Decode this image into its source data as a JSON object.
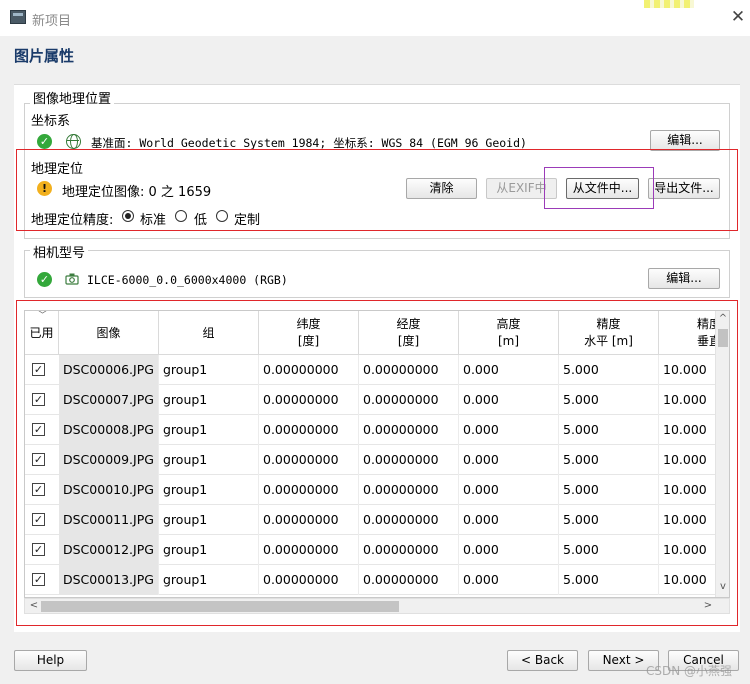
{
  "window": {
    "title": "新项目",
    "close_glyph": "✕"
  },
  "page_title": "图片属性",
  "geo_position": {
    "group_title": "图像地理位置",
    "crs_label": "坐标系",
    "crs_value": "基准面: World Geodetic System 1984; 坐标系: WGS 84 (EGM 96 Geoid)",
    "edit_button": "编辑..."
  },
  "georef": {
    "title": "地理定位",
    "status_text": "地理定位图像: 0 之 1659",
    "accuracy_label": "地理定位精度:",
    "accuracy_options": [
      "标准",
      "低",
      "定制"
    ],
    "accuracy_selected": "标准",
    "buttons": {
      "clear": "清除",
      "from_exif": "从EXIF中",
      "from_file": "从文件中...",
      "export": "导出文件..."
    }
  },
  "camera": {
    "group_title": "相机型号",
    "model": "ILCE-6000_0.0_6000x4000 (RGB)",
    "edit_button": "编辑..."
  },
  "table": {
    "sort_glyph": "﹀",
    "columns": [
      {
        "l1": "已用",
        "l2": ""
      },
      {
        "l1": "图像",
        "l2": ""
      },
      {
        "l1": "组",
        "l2": ""
      },
      {
        "l1": "纬度",
        "l2": "[度]"
      },
      {
        "l1": "经度",
        "l2": "[度]"
      },
      {
        "l1": "高度",
        "l2": "[m]"
      },
      {
        "l1": "精度",
        "l2": "水平 [m]"
      },
      {
        "l1": "精度",
        "l2": "垂直"
      }
    ],
    "rows": [
      {
        "enabled": "✓",
        "image": "DSC00006.JPG",
        "group": "group1",
        "lat": "0.00000000",
        "lon": "0.00000000",
        "alt": "0.000",
        "acc_h": "5.000",
        "acc_v": "10.000"
      },
      {
        "enabled": "✓",
        "image": "DSC00007.JPG",
        "group": "group1",
        "lat": "0.00000000",
        "lon": "0.00000000",
        "alt": "0.000",
        "acc_h": "5.000",
        "acc_v": "10.000"
      },
      {
        "enabled": "✓",
        "image": "DSC00008.JPG",
        "group": "group1",
        "lat": "0.00000000",
        "lon": "0.00000000",
        "alt": "0.000",
        "acc_h": "5.000",
        "acc_v": "10.000"
      },
      {
        "enabled": "✓",
        "image": "DSC00009.JPG",
        "group": "group1",
        "lat": "0.00000000",
        "lon": "0.00000000",
        "alt": "0.000",
        "acc_h": "5.000",
        "acc_v": "10.000"
      },
      {
        "enabled": "✓",
        "image": "DSC00010.JPG",
        "group": "group1",
        "lat": "0.00000000",
        "lon": "0.00000000",
        "alt": "0.000",
        "acc_h": "5.000",
        "acc_v": "10.000"
      },
      {
        "enabled": "✓",
        "image": "DSC00011.JPG",
        "group": "group1",
        "lat": "0.00000000",
        "lon": "0.00000000",
        "alt": "0.000",
        "acc_h": "5.000",
        "acc_v": "10.000"
      },
      {
        "enabled": "✓",
        "image": "DSC00012.JPG",
        "group": "group1",
        "lat": "0.00000000",
        "lon": "0.00000000",
        "alt": "0.000",
        "acc_h": "5.000",
        "acc_v": "10.000"
      },
      {
        "enabled": "✓",
        "image": "DSC00013.JPG",
        "group": "group1",
        "lat": "0.00000000",
        "lon": "0.00000000",
        "alt": "0.000",
        "acc_h": "5.000",
        "acc_v": "10.000"
      }
    ],
    "scroll_left": "<",
    "scroll_right": ">",
    "scroll_up": "^",
    "scroll_down": "v"
  },
  "footer": {
    "help": "Help",
    "back": "< Back",
    "next": "Next >",
    "cancel": "Cancel"
  },
  "watermark": "CSDN @小燕强",
  "colors": {
    "highlight_red": "#e0272b",
    "highlight_purple": "#9b3bb8",
    "title_blue": "#1a3b6a",
    "ok_green": "#34a83b",
    "warn_orange": "#f2b01e"
  },
  "icons": {
    "app": "app-logo-icon",
    "ok": "check-circle-icon",
    "warn": "warning-circle-icon",
    "globe": "globe-icon",
    "camera": "camera-icon"
  }
}
